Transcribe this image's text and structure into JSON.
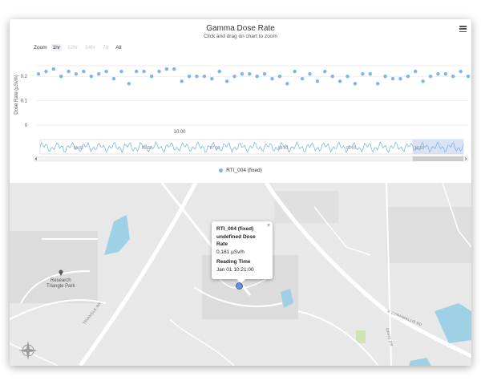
{
  "chart": {
    "title": "Gamma Dose Rate",
    "subtitle": "Click and drag on chart to zoom",
    "zoom_label": "Zoom",
    "zoom_options": [
      {
        "label": "1hr",
        "state": "active"
      },
      {
        "label": "12hr",
        "state": "disabled"
      },
      {
        "label": "24hr",
        "state": "disabled"
      },
      {
        "label": "7d",
        "state": "disabled"
      },
      {
        "label": "All",
        "state": "normal"
      }
    ],
    "legend_label": "RTI_004 (fixed)",
    "colors": {
      "series": "#7cb5ec",
      "navigator_fill": "#c9d7ee",
      "grid": "#e6e6e6"
    }
  },
  "chart_data": {
    "type": "scatter",
    "title": "Gamma Dose Rate",
    "ylabel": "Dose Rate (µSv/h)",
    "xlabel": "",
    "ylim": [
      0,
      0.25
    ],
    "yticks": [
      "0",
      "0.1",
      "0.2"
    ],
    "xticks": [
      "10:00"
    ],
    "navigator_ticks": [
      "05:00",
      "06:00",
      "07:00",
      "08:00",
      "09:00",
      "10:00"
    ],
    "series": [
      {
        "name": "RTI_004 (fixed)",
        "values": [
          0.21,
          0.22,
          0.23,
          0.2,
          0.22,
          0.21,
          0.22,
          0.2,
          0.21,
          0.22,
          0.19,
          0.22,
          0.17,
          0.22,
          0.22,
          0.2,
          0.22,
          0.23,
          0.23,
          0.18,
          0.2,
          0.2,
          0.2,
          0.19,
          0.22,
          0.18,
          0.2,
          0.21,
          0.21,
          0.2,
          0.21,
          0.19,
          0.2,
          0.17,
          0.22,
          0.19,
          0.21,
          0.18,
          0.22,
          0.2,
          0.18,
          0.2,
          0.17,
          0.21,
          0.21,
          0.17,
          0.2,
          0.19,
          0.19,
          0.2,
          0.22,
          0.18,
          0.2,
          0.21,
          0.21,
          0.2,
          0.22,
          0.2
        ]
      }
    ]
  },
  "map": {
    "popup": {
      "title": "RTI_004 (fixed)",
      "metric": "undefined Dose Rate",
      "value": "0.181 µSv/h",
      "time_label": "Reading Time",
      "time_value": "Jan 01 10:21:00",
      "close": "×"
    },
    "poi_line1": "Research",
    "poi_line2": "Triangle Park",
    "roads": [
      "TRIANGLE DR",
      "E CORNWALLIS RD",
      "DAVIS DR"
    ]
  }
}
